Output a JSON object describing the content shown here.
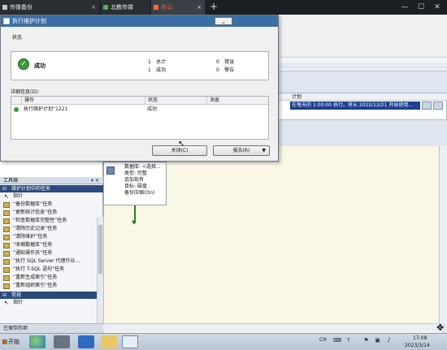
{
  "browser": {
    "tabs": [
      {
        "label": "传媒备份",
        "active": false
      },
      {
        "label": "北教传媒",
        "active": false
      },
      {
        "label": "办公",
        "active": true
      }
    ],
    "new_tab_glyph": "+",
    "window_controls": [
      "—",
      "☐",
      "✕"
    ]
  },
  "dialog": {
    "title": "执行维护计划",
    "status_label": "状态",
    "status": {
      "result": "成功",
      "summary": [
        {
          "count": "1",
          "label": "总计",
          "count2": "0",
          "label2": "错误"
        },
        {
          "count": "1",
          "label": "成功",
          "count2": "0",
          "label2": "警告"
        }
      ]
    },
    "details_label": "详细信息(D):",
    "columns": [
      "操作",
      "状态",
      "消息"
    ],
    "rows": [
      {
        "action": "执行维护计划“1221",
        "status": "成功",
        "message": ""
      }
    ],
    "buttons": {
      "close": "关闭(C)",
      "report": "报告(R)"
    }
  },
  "background": {
    "schedule_header": "计划",
    "schedule_row": "在每天的 1:00:00 执行。将从 2022/12/21 开始使用...",
    "task_node_lines": [
      "数据库: <选择...",
      "类型: 完整",
      "追加现有",
      "目标: 磁盘",
      "备份压缩(On)"
    ],
    "toolbox": {
      "title": "工具箱",
      "section1": "维护计划中的任务",
      "items": [
        "指针",
        "“备份数据库”任务",
        "“更新统计信息”任务",
        "“检查数据库完整性”任务",
        "“清除历史记录”任务",
        "“清除维护”任务",
        "“收缩数据库”任务",
        "“通知操作员”任务",
        "“执行 SQL Server 代理作业...",
        "“执行 T-SQL 语句”任务",
        "“重新生成索引”任务",
        "“重新组织索引”任务"
      ],
      "section2": "常规",
      "section2_items": [
        "指针"
      ]
    },
    "status_text": "已保存的项"
  },
  "taskbar": {
    "start": "开始",
    "lang": "CH",
    "time": "17:08",
    "date": "2023/3/14"
  }
}
